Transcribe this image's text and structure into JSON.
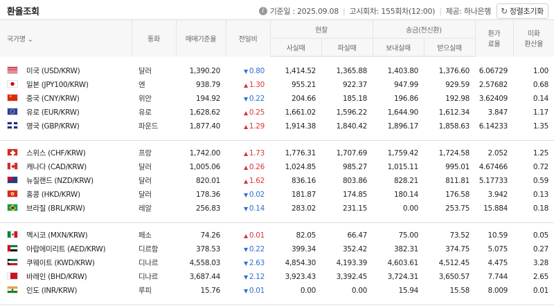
{
  "header": {
    "title": "환율조회",
    "base_date": "기준일 : 2025.09.08",
    "notice": "고시회차: 155회차(12:00)",
    "provider": "제공: 하나은행",
    "reset_label": "정렬초기화"
  },
  "columns": {
    "country": "국가명",
    "currency": "통화",
    "base_rate": "매매기준율",
    "change": "전일비",
    "cash": "현찰",
    "cash_buy": "사실때",
    "cash_sell": "파실때",
    "wire": "송금(전신환)",
    "wire_send": "보내실때",
    "wire_receive": "받으실때",
    "usd_rate_line1": "환가",
    "usd_rate_line2": "료율",
    "usd_conv_line1": "미화",
    "usd_conv_line2": "환산율"
  },
  "rows": [
    {
      "flag": "us-flag",
      "name": "미국 (USD/KRW)",
      "unit": "달러",
      "base": "1,390.20",
      "dir": "down",
      "change": "0.80",
      "cash_buy": "1,414.52",
      "cash_sell": "1,365.88",
      "send": "1,403.80",
      "receive": "1,376.60",
      "rate": "6.06729",
      "usd": "1.00"
    },
    {
      "flag": "jp-flag",
      "name": "일본 (JPY100/KRW)",
      "unit": "엔",
      "base": "938.79",
      "dir": "up",
      "change": "1.30",
      "cash_buy": "955.21",
      "cash_sell": "922.37",
      "send": "947.99",
      "receive": "929.59",
      "rate": "2.57682",
      "usd": "0.68"
    },
    {
      "flag": "cn-flag",
      "name": "중국 (CNY/KRW)",
      "unit": "위안",
      "base": "194.92",
      "dir": "down",
      "change": "0.22",
      "cash_buy": "204.66",
      "cash_sell": "185.18",
      "send": "196.86",
      "receive": "192.98",
      "rate": "3.62409",
      "usd": "0.14"
    },
    {
      "flag": "eu-flag",
      "name": "유로 (EUR/KRW)",
      "unit": "유로",
      "base": "1,628.62",
      "dir": "up",
      "change": "0.25",
      "cash_buy": "1,661.02",
      "cash_sell": "1,596.22",
      "send": "1,644.90",
      "receive": "1,612.34",
      "rate": "3.847",
      "usd": "1.17"
    },
    {
      "flag": "gb-flag",
      "name": "영국 (GBP/KRW)",
      "unit": "파운드",
      "base": "1,877.40",
      "dir": "up",
      "change": "1.29",
      "cash_buy": "1,914.38",
      "cash_sell": "1,840.42",
      "send": "1,896.17",
      "receive": "1,858.63",
      "rate": "6.14233",
      "usd": "1.35"
    },
    {
      "flag": "ch-flag",
      "name": "스위스 (CHF/KRW)",
      "unit": "프랑",
      "base": "1,742.00",
      "dir": "up",
      "change": "1.73",
      "cash_buy": "1,776.31",
      "cash_sell": "1,707.69",
      "send": "1,759.42",
      "receive": "1,724.58",
      "rate": "2.052",
      "usd": "1.25"
    },
    {
      "flag": "ca-flag",
      "name": "캐나다 (CAD/KRW)",
      "unit": "달러",
      "base": "1,005.06",
      "dir": "up",
      "change": "0.26",
      "cash_buy": "1,024.85",
      "cash_sell": "985.27",
      "send": "1,015.11",
      "receive": "995.01",
      "rate": "4.67466",
      "usd": "0.72"
    },
    {
      "flag": "nz-flag",
      "name": "뉴질랜드 (NZD/KRW)",
      "unit": "달러",
      "base": "820.01",
      "dir": "up",
      "change": "1.62",
      "cash_buy": "836.16",
      "cash_sell": "803.86",
      "send": "828.21",
      "receive": "811.81",
      "rate": "5.17733",
      "usd": "0.59"
    },
    {
      "flag": "hk-flag",
      "name": "홍콩 (HKD/KRW)",
      "unit": "달러",
      "base": "178.36",
      "dir": "down",
      "change": "0.02",
      "cash_buy": "181.87",
      "cash_sell": "174.85",
      "send": "180.14",
      "receive": "176.58",
      "rate": "3.942",
      "usd": "0.13"
    },
    {
      "flag": "br-flag",
      "name": "브라질 (BRL/KRW)",
      "unit": "레알",
      "base": "256.83",
      "dir": "down",
      "change": "0.14",
      "cash_buy": "283.02",
      "cash_sell": "231.15",
      "send": "0.00",
      "receive": "253.75",
      "rate": "15.884",
      "usd": "0.18"
    },
    {
      "flag": "mx-flag",
      "name": "멕시코 (MXN/KRW)",
      "unit": "페소",
      "base": "74.26",
      "dir": "up",
      "change": "0.01",
      "cash_buy": "82.05",
      "cash_sell": "66.47",
      "send": "75.00",
      "receive": "73.52",
      "rate": "10.59",
      "usd": "0.05"
    },
    {
      "flag": "ae-flag",
      "name": "아랍에미리트 (AED/KRW)",
      "unit": "디르함",
      "base": "378.53",
      "dir": "down",
      "change": "0.22",
      "cash_buy": "399.34",
      "cash_sell": "352.42",
      "send": "382.31",
      "receive": "374.75",
      "rate": "5.075",
      "usd": "0.27"
    },
    {
      "flag": "kw-flag",
      "name": "쿠웨이트 (KWD/KRW)",
      "unit": "디나르",
      "base": "4,558.03",
      "dir": "down",
      "change": "2.63",
      "cash_buy": "4,854.30",
      "cash_sell": "4,193.39",
      "send": "4,603.61",
      "receive": "4,512.45",
      "rate": "4.475",
      "usd": "3.28"
    },
    {
      "flag": "bh-flag",
      "name": "바레인 (BHD/KRW)",
      "unit": "디나르",
      "base": "3,687.44",
      "dir": "down",
      "change": "2.12",
      "cash_buy": "3,923.43",
      "cash_sell": "3,392.45",
      "send": "3,724.31",
      "receive": "3,650.57",
      "rate": "7.744",
      "usd": "2.65"
    },
    {
      "flag": "in-flag",
      "name": "인도 (INR/KRW)",
      "unit": "루피",
      "base": "15.76",
      "dir": "down",
      "change": "0.01",
      "cash_buy": "0.00",
      "cash_sell": "0.00",
      "send": "15.94",
      "receive": "15.58",
      "rate": "8.009",
      "usd": "0.01"
    }
  ],
  "colors": {
    "up": "#d93636",
    "down": "#2d6fd1",
    "header_bg": "#f7f7f7",
    "border": "#dcdcdc"
  }
}
